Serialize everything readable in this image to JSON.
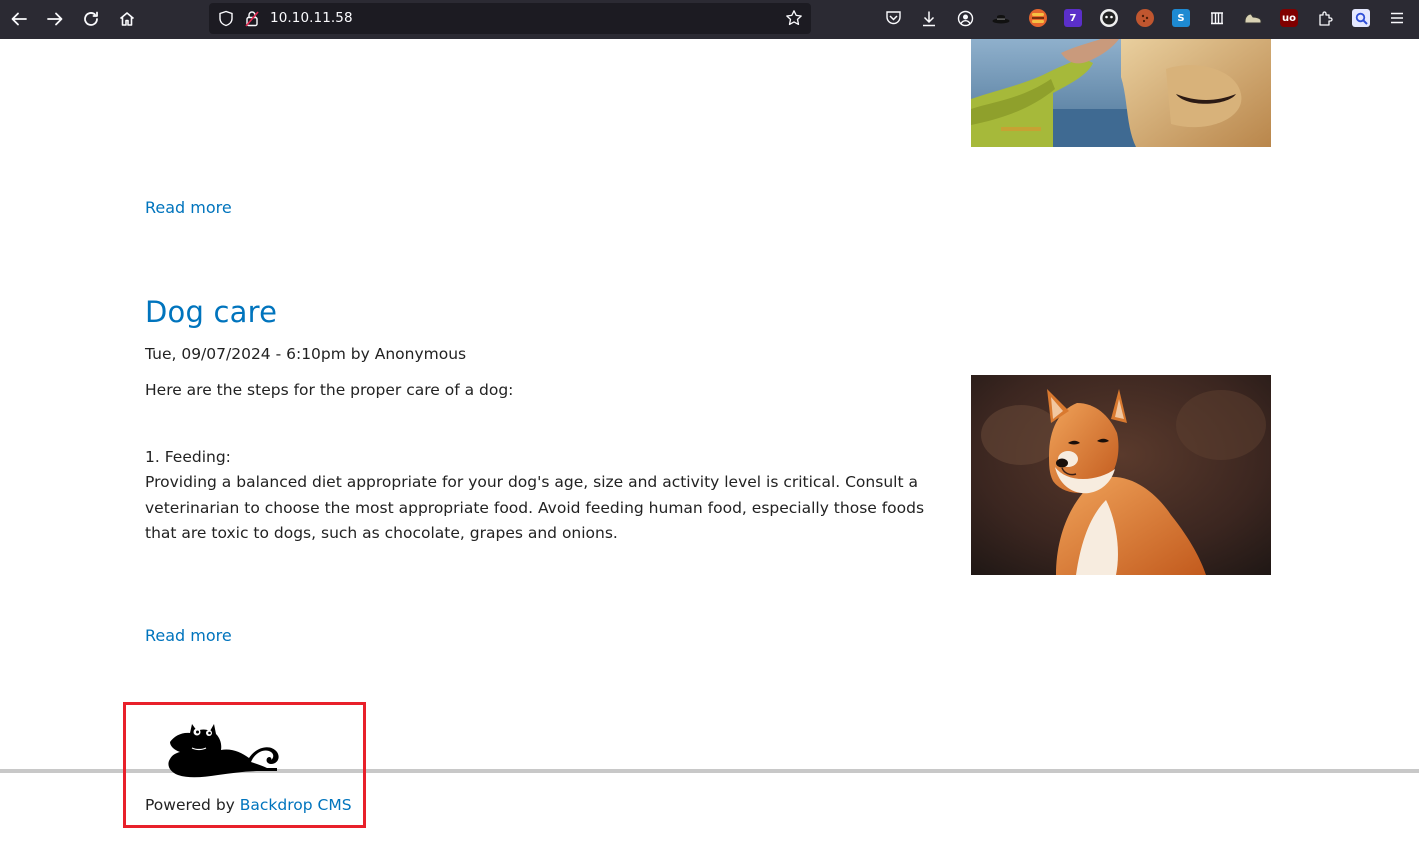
{
  "browser": {
    "url": "10.10.11.58",
    "extension_badge_count": "7"
  },
  "posts": [
    {
      "read_more_label": "Read more"
    },
    {
      "title": "Dog care",
      "meta": "Tue, 09/07/2024 - 6:10pm by Anonymous",
      "intro": "Here are the steps for the proper care of a dog:",
      "section_heading": "1. Feeding:",
      "section_body": "Providing a balanced diet appropriate for your dog's age, size and activity level is critical. Consult a veterinarian to choose the most appropriate food. Avoid feeding human food, especially those foods that are toxic to dogs, such as chocolate, grapes and onions.",
      "read_more_label": "Read more"
    }
  ],
  "footer": {
    "powered_prefix": "Powered by ",
    "powered_link": "Backdrop CMS"
  },
  "colors": {
    "link": "#0074bd",
    "toolbar_bg": "#2b2a33",
    "highlight": "#e8202a"
  }
}
